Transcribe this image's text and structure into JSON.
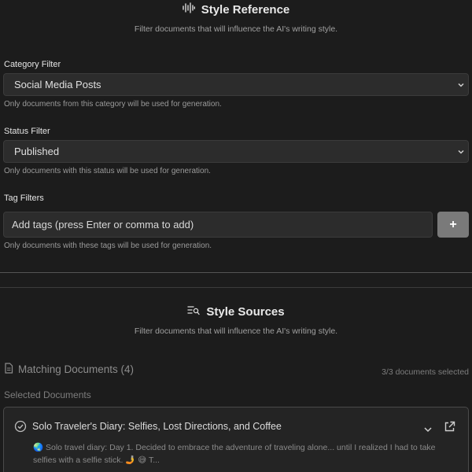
{
  "style_reference": {
    "title": "Style Reference",
    "icon": "audio-waveform-icon",
    "subtitle": "Filter documents that will influence the AI's writing style."
  },
  "category_filter": {
    "label": "Category Filter",
    "value": "Social Media Posts",
    "help": "Only documents from this category will be used for generation."
  },
  "status_filter": {
    "label": "Status Filter",
    "value": "Published",
    "help": "Only documents with this status will be used for generation."
  },
  "tag_filters": {
    "label": "Tag Filters",
    "placeholder": "Add tags (press Enter or comma to add)",
    "add_label": "+",
    "help": "Only documents with these tags will be used for generation."
  },
  "style_sources": {
    "title": "Style Sources",
    "icon": "list-search-icon",
    "subtitle": "Filter documents that will influence the AI's writing style."
  },
  "matching": {
    "label": "Matching Documents (4)",
    "selected_count": "3/3 documents selected",
    "selected_heading": "Selected Documents"
  },
  "documents": [
    {
      "title": "Solo Traveler's Diary: Selfies, Lost Directions, and Coffee",
      "preview": "🌏 Solo travel diary: Day 1. Decided to embrace the adventure of traveling alone... until I realized I had to take selfies with a selfie stick. 🤳 😅 T..."
    }
  ],
  "colors": {
    "background": "#1c1c1c",
    "field": "#2c2c2c",
    "add_button": "#7a7a7a",
    "card_border": "#4a4a4a"
  }
}
